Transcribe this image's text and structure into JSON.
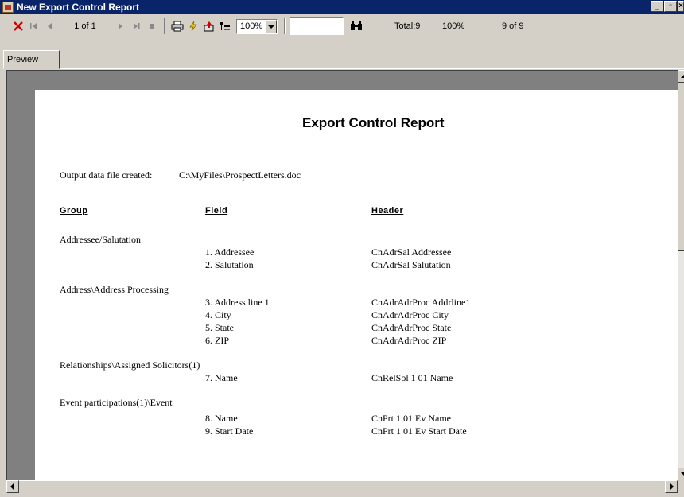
{
  "window": {
    "title": "New Export Control Report"
  },
  "toolbar": {
    "page_indicator": "1 of 1",
    "zoom": "100%",
    "search_value": "",
    "total": "Total:9",
    "percent": "100%",
    "record_count": "9 of 9"
  },
  "tabs": [
    {
      "label": "Preview"
    }
  ],
  "report": {
    "title": "Export Control Report",
    "output_label": "Output data file created:",
    "output_path": "C:\\MyFiles\\ProspectLetters.doc",
    "headers": {
      "group": "Group",
      "field": "Field",
      "header": "Header"
    },
    "groups": [
      {
        "name": "Addressee/Salutation",
        "rows": [
          {
            "field": "1. Addressee",
            "header": "CnAdrSal  Addressee"
          },
          {
            "field": "2. Salutation",
            "header": "CnAdrSal  Salutation"
          }
        ]
      },
      {
        "name": "Address\\Address Processing",
        "rows": [
          {
            "field": "3. Address line 1",
            "header": "CnAdrAdrProc  Addrline1"
          },
          {
            "field": "4. City",
            "header": "CnAdrAdrProc  City"
          },
          {
            "field": "5. State",
            "header": "CnAdrAdrProc  State"
          },
          {
            "field": "6. ZIP",
            "header": "CnAdrAdrProc  ZIP"
          }
        ]
      },
      {
        "name": "Relationships\\Assigned Solicitors(1)",
        "rows": [
          {
            "field": "7. Name",
            "header": "CnRelSol  1  01  Name"
          }
        ]
      },
      {
        "name": "Event participations(1)\\Event",
        "rows": [
          {
            "field": "8. Name",
            "header": "CnPrt  1  01  Ev  Name"
          },
          {
            "field": "9. Start Date",
            "header": "CnPrt  1  01  Ev  Start  Date"
          }
        ]
      }
    ]
  },
  "colors": {
    "titlebar": "#0a246a",
    "chrome": "#d4d0c8",
    "viewport": "#808080",
    "close_red": "#d00000"
  },
  "icons": [
    "app-icon",
    "close-x-icon",
    "first-page-icon",
    "prev-page-icon",
    "next-page-icon",
    "last-page-icon",
    "stop-icon",
    "print-icon",
    "lightning-icon",
    "export-icon",
    "tree-icon",
    "binoculars-icon"
  ]
}
